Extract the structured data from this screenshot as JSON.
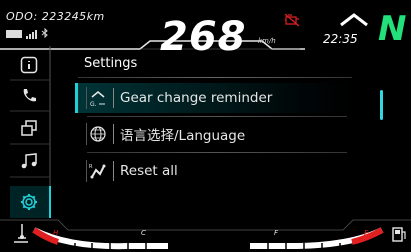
{
  "status": {
    "odometer": "ODO: 223245km",
    "speed": "268",
    "speed_unit": "km/h",
    "time": "22:35",
    "gear": "N",
    "warning_icon": "engine-warning-icon",
    "bluetooth_icon": "bluetooth-icon"
  },
  "sidebar": {
    "items": [
      {
        "name": "info",
        "icon": "info-icon"
      },
      {
        "name": "phone",
        "icon": "phone-icon"
      },
      {
        "name": "screens",
        "icon": "window-switch-icon"
      },
      {
        "name": "music",
        "icon": "music-icon"
      },
      {
        "name": "settings",
        "icon": "gear-icon"
      }
    ]
  },
  "settings": {
    "title": "Settings",
    "items": [
      {
        "label": "Gear change reminder",
        "icon": "gear-shift-icon",
        "selected": true
      },
      {
        "label": "语言选择/Language",
        "icon": "globe-icon",
        "selected": false
      },
      {
        "label": "Reset all",
        "icon": "reset-icon",
        "selected": false
      }
    ]
  },
  "gauges": {
    "temp_cold": "C",
    "temp_hot": "H",
    "fuel_full": "F",
    "fuel_empty": "E"
  },
  "colors": {
    "accent": "#1fd0d8",
    "gear": "#22e07a",
    "warning": "#e02020"
  }
}
